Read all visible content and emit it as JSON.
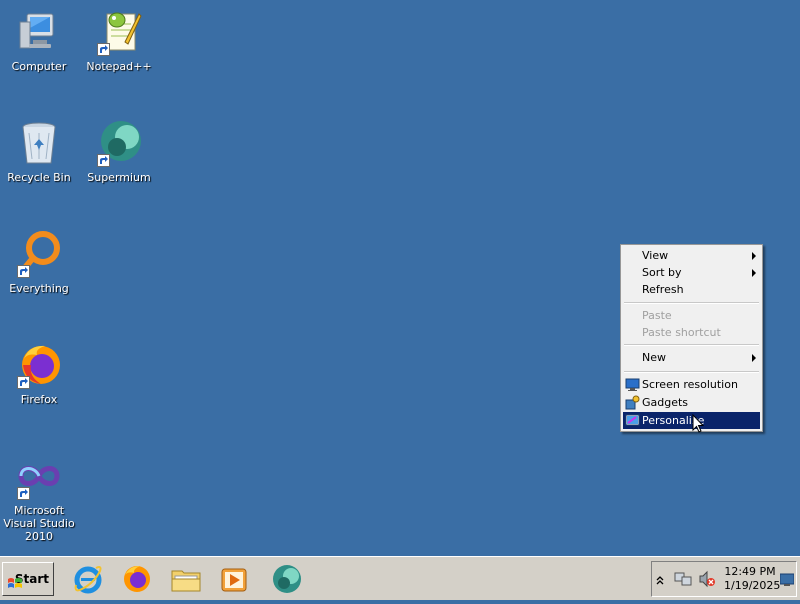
{
  "desktop": {
    "icons": [
      {
        "label": "Computer",
        "icon": "computer-icon"
      },
      {
        "label": "Notepad++",
        "icon": "notepadpp-icon"
      },
      {
        "label": "Recycle Bin",
        "icon": "recycle-bin-icon"
      },
      {
        "label": "Supermium",
        "icon": "supermium-icon"
      },
      {
        "label": "Everything",
        "icon": "everything-icon"
      },
      {
        "label": "Firefox",
        "icon": "firefox-icon"
      },
      {
        "label": "Microsoft Visual Studio 2010",
        "icon": "visual-studio-icon"
      }
    ],
    "background_color": "#3a6ea5"
  },
  "context_menu": {
    "items": [
      {
        "label": "View",
        "submenu": true
      },
      {
        "label": "Sort by",
        "submenu": true
      },
      {
        "label": "Refresh"
      },
      {
        "label": "Paste",
        "disabled": true
      },
      {
        "label": "Paste shortcut",
        "disabled": true
      },
      {
        "label": "New",
        "submenu": true
      },
      {
        "label": "Screen resolution",
        "icon": "monitor-icon"
      },
      {
        "label": "Gadgets",
        "icon": "gadgets-icon"
      },
      {
        "label": "Personalize",
        "icon": "personalize-icon",
        "selected": true
      }
    ],
    "selection_color": "#0a246a"
  },
  "taskbar": {
    "start_label": "Start",
    "pinned": [
      "internet-explorer-icon",
      "firefox-icon",
      "explorer-folder-icon",
      "media-player-icon",
      "supermium-icon"
    ],
    "clock_time": "12:49 PM",
    "clock_date": "1/19/2025"
  }
}
